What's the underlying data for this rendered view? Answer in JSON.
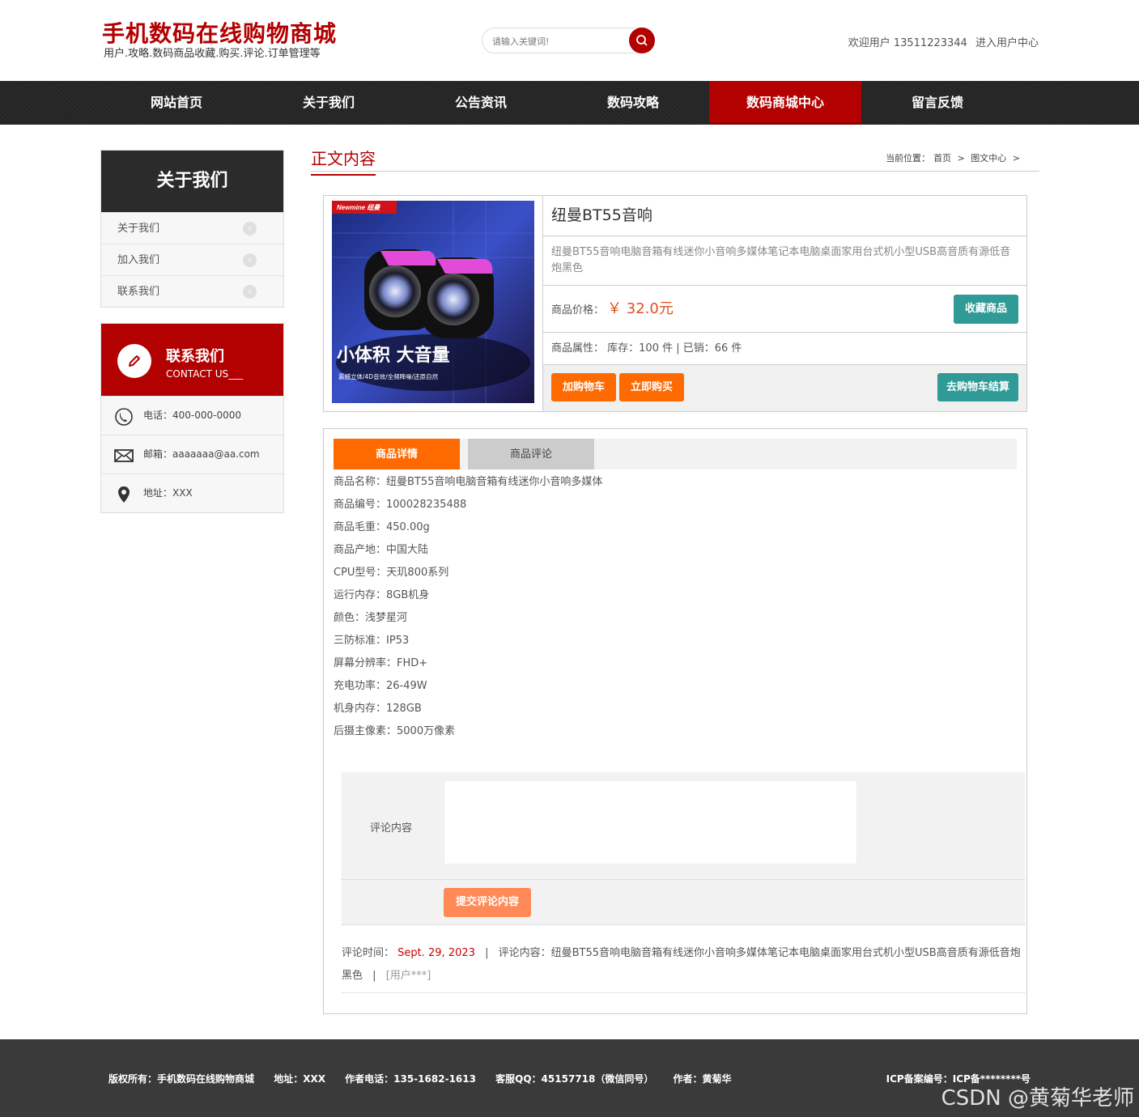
{
  "header": {
    "site_title": "手机数码在线购物商城",
    "site_subtitle": "用户.攻略.数码商品收藏.购买.评论.订单管理等",
    "search_placeholder": "请输入关键词!",
    "welcome_text": "欢迎用户 13511223344",
    "user_center_link": "进入用户中心"
  },
  "nav": {
    "items": [
      "网站首页",
      "关于我们",
      "公告资讯",
      "数码攻略",
      "数码商城中心",
      "留言反馈"
    ],
    "active": "数码商城中心"
  },
  "sidebar": {
    "title": "关于我们",
    "items": [
      {
        "label": "关于我们"
      },
      {
        "label": "加入我们"
      },
      {
        "label": "联系我们"
      }
    ],
    "contact": {
      "title": "联系我们",
      "subtitle": "CONTACT US___",
      "phone": "电话：400-000-0000",
      "email": "邮箱：aaaaaaa@aa.com",
      "address": "地址：XXX"
    }
  },
  "main": {
    "section_title": "正文内容",
    "breadcrumb": {
      "prefix": "当前位置：",
      "home": "首页",
      "sep": ">",
      "current": "图文中心",
      "tail": ">"
    }
  },
  "product": {
    "image_brand": "Newmine 纽曼",
    "image_slogan": "小体积 大音量",
    "image_tagline": "震撼立体/4D音效/全频降噪/还原自然",
    "title": "纽曼BT55音响",
    "description": "纽曼BT55音响电脑音箱有线迷你小音响多媒体笔记本电脑桌面家用台式机小型USB高音质有源低音炮黑色",
    "price_label": "商品价格：",
    "price_value": "￥ 32.0元",
    "favorite_button": "收藏商品",
    "attr_label": "商品属性：",
    "attr_value": "库存：100 件 | 已销：66 件",
    "add_cart_button": "加购物车",
    "buy_now_button": "立即购买",
    "checkout_button": "去购物车结算"
  },
  "detail": {
    "tabs": [
      "商品详情",
      "商品评论"
    ],
    "active_tab": "商品详情",
    "specs": [
      "商品名称：纽曼BT55音响电脑音箱有线迷你小音响多媒体",
      "商品编号：100028235488",
      "商品毛重：450.00g",
      "商品产地：中国大陆",
      "CPU型号：天玑800系列",
      "运行内存：8GB机身",
      "颜色：浅梦星河",
      "三防标准：IP53",
      "屏幕分辨率：FHD+",
      "充电功率：26-49W",
      "机身内存：128GB",
      "后摄主像素：5000万像素"
    ],
    "comment_form": {
      "label": "评论内容",
      "submit_button": "提交评论内容"
    },
    "comments": [
      {
        "time_label": "评论时间：",
        "date": "Sept. 29, 2023",
        "sep": "|",
        "content_label": "评论内容：",
        "content": "纽曼BT55音响电脑音箱有线迷你小音响多媒体笔记本电脑桌面家用台式机小型USB高音质有源低音炮黑色",
        "user": "[用户***]"
      }
    ]
  },
  "footer": {
    "copyright": "版权所有：手机数码在线购物商城",
    "address": "地址：XXX",
    "author_phone": "作者电话：135-1682-1613",
    "qq": "客服QQ：45157718（微信同号）",
    "author": "作者：黄菊华",
    "icp": "ICP备案编号：ICP备********号"
  },
  "watermark": "CSDN @黄菊华老师",
  "colors": {
    "brand_red": "#b30000",
    "orange": "#ff6a00",
    "teal": "#2f9a96",
    "dark": "#2b2b2b"
  }
}
